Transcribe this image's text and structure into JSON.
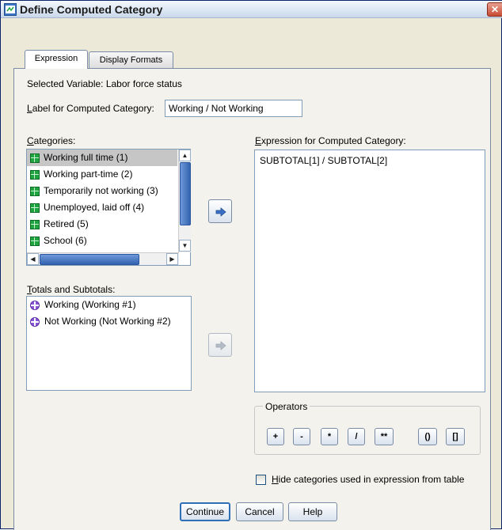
{
  "window": {
    "title": "Define Computed Category",
    "close_glyph": "✕",
    "icon": "spss-dialog-icon"
  },
  "tabs": [
    {
      "label": "Expression",
      "active": true
    },
    {
      "label": "Display Formats",
      "active": false
    }
  ],
  "selected_variable": "Selected Variable: Labor force status",
  "label_field": {
    "label_prefix": "L",
    "label_rest": "abel for Computed Category:",
    "value": "Working / Not Working"
  },
  "categories": {
    "label_prefix": "C",
    "label_rest": "ategories:",
    "items": [
      {
        "label": "Working full time (1)",
        "selected": true
      },
      {
        "label": "Working part-time (2)"
      },
      {
        "label": "Temporarily not working (3)"
      },
      {
        "label": "Unemployed, laid off (4)"
      },
      {
        "label": "Retired (5)"
      },
      {
        "label": "School (6)"
      }
    ]
  },
  "totals": {
    "label_prefix": "T",
    "label_rest": "otals and Subtotals:",
    "items": [
      {
        "label": "Working (Working #1)"
      },
      {
        "label": "Not Working (Not Working #2)"
      }
    ]
  },
  "expression": {
    "label_prefix": "E",
    "label_rest": "xpression for Computed Category:",
    "value": "SUBTOTAL[1] / SUBTOTAL[2]"
  },
  "operators": {
    "legend": "Operators",
    "buttons": [
      "+",
      "-",
      "*",
      "/",
      "**",
      "()",
      "[]"
    ]
  },
  "hide_checkbox": {
    "label_prefix": "H",
    "label_rest": "ide categories used in expression from table",
    "checked": false
  },
  "buttons": {
    "continue": "Continue",
    "cancel": "Cancel",
    "help": "Help"
  },
  "colors": {
    "accent": "#2f6fb8",
    "selection": "#c6c6c6",
    "category_icon": "#1fa53f",
    "total_icon": "#8a55d8"
  }
}
